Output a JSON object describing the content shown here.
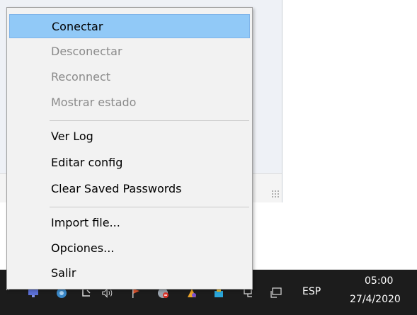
{
  "menu": {
    "items": [
      {
        "label": "Conectar",
        "state": "highlighted"
      },
      {
        "label": "Desconectar",
        "state": "disabled"
      },
      {
        "label": "Reconnect",
        "state": "disabled"
      },
      {
        "label": "Mostrar estado",
        "state": "disabled"
      },
      {
        "label": "Ver Log",
        "state": "enabled"
      },
      {
        "label": "Editar config",
        "state": "enabled"
      },
      {
        "label": "Clear Saved Passwords",
        "state": "enabled"
      },
      {
        "label": "Import file...",
        "state": "enabled"
      },
      {
        "label": "Opciones...",
        "state": "enabled"
      },
      {
        "label": "Salir",
        "state": "enabled"
      }
    ]
  },
  "taskbar": {
    "language": "ESP",
    "time": "05:00",
    "date": "27/4/2020",
    "tray_icons": [
      "chevron-up-icon",
      "monitor-app-icon",
      "cloud-sync-icon",
      "pen-tablet-icon",
      "speaker-icon",
      "flag-app-icon",
      "shield-app-icon",
      "mail-app-icon",
      "cloud-app-icon",
      "network-icon",
      "display-icon"
    ]
  },
  "colors": {
    "highlight": "#91c9f7",
    "menu_bg": "#f2f2f2",
    "disabled_text": "#8a8a8a",
    "taskbar_bg": "#1c1c1c"
  }
}
